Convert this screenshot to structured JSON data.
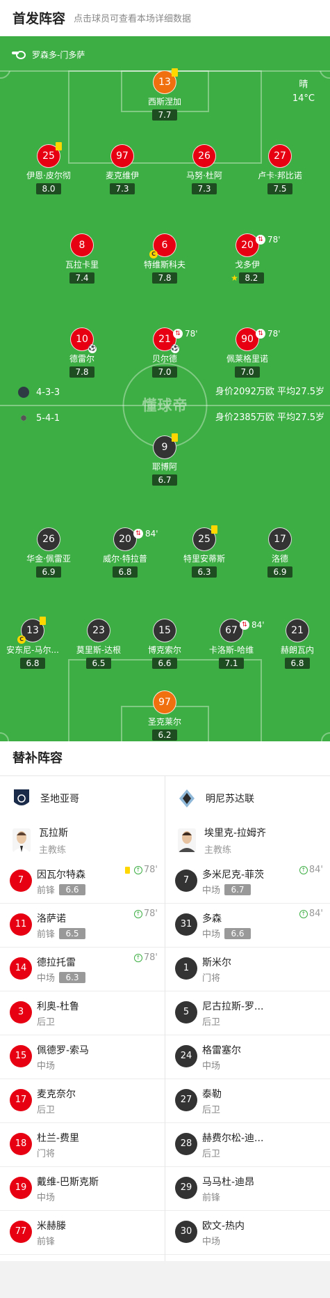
{
  "header": {
    "title": "首发阵容",
    "subtitle": "点击球员可查看本场详细数据"
  },
  "venue": "罗森多-门多萨",
  "weather": {
    "condition": "晴",
    "temperature": "14°C"
  },
  "watermark": "懂球帝",
  "home": {
    "formation": "4-3-3",
    "value_text": "身价2092万欧 平均27.5岁",
    "players": [
      {
        "num": "13",
        "name": "西斯涅加",
        "rating": "7.7",
        "gk": true,
        "yellow": true
      },
      {
        "num": "25",
        "name": "伊恩·皮尔彻",
        "rating": "8.0",
        "yellow": true
      },
      {
        "num": "97",
        "name": "麦克维伊",
        "rating": "7.3"
      },
      {
        "num": "26",
        "name": "马努·杜阿",
        "rating": "7.3"
      },
      {
        "num": "27",
        "name": "卢卡·邦比诺",
        "rating": "7.5"
      },
      {
        "num": "8",
        "name": "瓦拉卡里",
        "rating": "7.4"
      },
      {
        "num": "6",
        "name": "特维斯科夫",
        "rating": "7.8",
        "captain": true
      },
      {
        "num": "20",
        "name": "戈多伊",
        "rating": "8.2",
        "sub_min": "78'",
        "star": true
      },
      {
        "num": "10",
        "name": "德雷尔",
        "rating": "7.8",
        "goal": true
      },
      {
        "num": "21",
        "name": "贝尔德",
        "rating": "7.0",
        "sub_min": "78'",
        "goal": true
      },
      {
        "num": "90",
        "name": "佩莱格里诺",
        "rating": "7.0",
        "sub_min": "78'"
      }
    ]
  },
  "away": {
    "formation": "5-4-1",
    "value_text": "身价2385万欧 平均27.5岁",
    "players": [
      {
        "num": "9",
        "name": "耶博阿",
        "rating": "6.7",
        "yellow": true
      },
      {
        "num": "26",
        "name": "华金·佩雷亚",
        "rating": "6.9"
      },
      {
        "num": "20",
        "name": "威尔·特拉普",
        "rating": "6.8",
        "sub_min": "84'"
      },
      {
        "num": "25",
        "name": "特里安蒂斯",
        "rating": "6.3",
        "yellow": true
      },
      {
        "num": "17",
        "name": "洛德",
        "rating": "6.9"
      },
      {
        "num": "13",
        "name": "安东尼-马尔...",
        "rating": "6.8",
        "yellow": true,
        "captain": true
      },
      {
        "num": "23",
        "name": "莫里斯-达根",
        "rating": "6.5"
      },
      {
        "num": "15",
        "name": "博克索尔",
        "rating": "6.6"
      },
      {
        "num": "67",
        "name": "卡洛斯-哈维",
        "rating": "7.1",
        "sub_min": "84'"
      },
      {
        "num": "21",
        "name": "赫朗瓦内",
        "rating": "6.8"
      },
      {
        "num": "97",
        "name": "圣克莱尔",
        "rating": "6.2",
        "gk": true
      }
    ]
  },
  "substitutes": {
    "title": "替补阵容",
    "home": {
      "team": "圣地亚哥",
      "coach": {
        "name": "瓦拉斯",
        "role": "主教练"
      },
      "players": [
        {
          "num": "7",
          "name": "因瓦尔特森",
          "pos": "前锋",
          "rating": "6.6",
          "in": "78'",
          "yellow": true
        },
        {
          "num": "11",
          "name": "洛萨诺",
          "pos": "前锋",
          "rating": "6.5",
          "in": "78'"
        },
        {
          "num": "14",
          "name": "德拉托雷",
          "pos": "中场",
          "rating": "6.3",
          "in": "78'"
        },
        {
          "num": "3",
          "name": "利奥-杜鲁",
          "pos": "后卫"
        },
        {
          "num": "15",
          "name": "佩德罗-索马",
          "pos": "中场"
        },
        {
          "num": "17",
          "name": "麦克奈尔",
          "pos": "后卫"
        },
        {
          "num": "18",
          "name": "杜兰-费里",
          "pos": "门将"
        },
        {
          "num": "19",
          "name": "戴维-巴斯克斯",
          "pos": "中场"
        },
        {
          "num": "77",
          "name": "米赫滕",
          "pos": "前锋"
        }
      ]
    },
    "away": {
      "team": "明尼苏达联",
      "coach": {
        "name": "埃里克-拉姆齐",
        "role": "主教练"
      },
      "players": [
        {
          "num": "7",
          "name": "多米尼克-菲茨",
          "pos": "中场",
          "rating": "6.7",
          "in": "84'"
        },
        {
          "num": "31",
          "name": "多森",
          "pos": "中场",
          "rating": "6.6",
          "in": "84'"
        },
        {
          "num": "1",
          "name": "斯米尔",
          "pos": "门将"
        },
        {
          "num": "5",
          "name": "尼古拉斯-罗...",
          "pos": "后卫"
        },
        {
          "num": "24",
          "name": "格雷塞尔",
          "pos": "中场"
        },
        {
          "num": "27",
          "name": "泰勒",
          "pos": "后卫"
        },
        {
          "num": "28",
          "name": "赫费尔松-迪...",
          "pos": "后卫"
        },
        {
          "num": "29",
          "name": "马马杜-迪昂",
          "pos": "前锋"
        },
        {
          "num": "30",
          "name": "欧文-热内",
          "pos": "中场"
        }
      ]
    }
  }
}
